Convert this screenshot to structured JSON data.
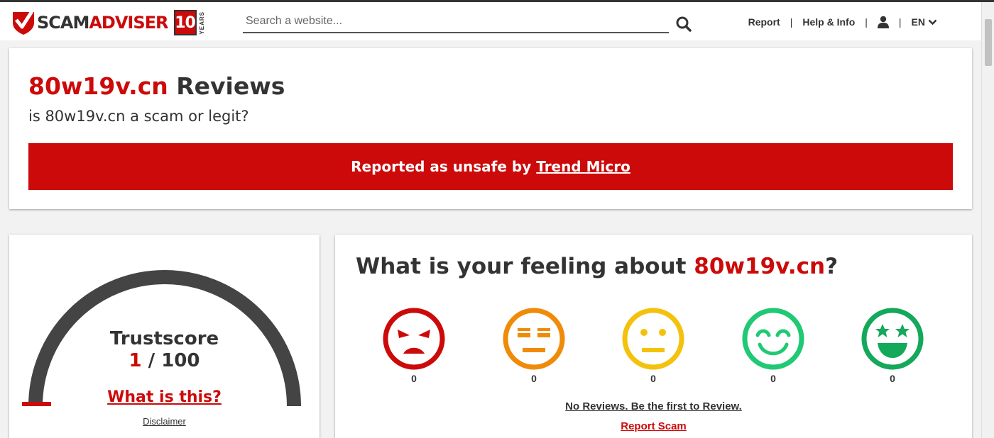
{
  "header": {
    "logo": {
      "scam": "SCAM",
      "adviser": "ADVISER",
      "badge": "10",
      "years": "YEARS"
    },
    "search": {
      "placeholder": "Search a website..."
    },
    "nav": {
      "report": "Report",
      "help": "Help & Info",
      "sep": "|",
      "lang": "EN"
    }
  },
  "main": {
    "domain": "80w19v.cn",
    "title_suffix": " Reviews",
    "subtitle": "is 80w19v.cn a scam or legit?",
    "alert": {
      "text": "Reported as unsafe by",
      "link": "Trend Micro"
    }
  },
  "trust": {
    "label": "Trustscore",
    "score": "1",
    "max": " / 100",
    "score_value": 1,
    "score_max": 100,
    "what_link": "What is this?",
    "disclaimer": "Disclaimer"
  },
  "feeling": {
    "title_prefix": "What is your feeling about ",
    "domain": "80w19v.cn",
    "title_suffix": "?",
    "emojis": [
      {
        "name": "angry",
        "color": "#cc0a0a",
        "count": "0"
      },
      {
        "name": "annoyed",
        "color": "#f08b0a",
        "count": "0"
      },
      {
        "name": "neutral",
        "color": "#f4c20d",
        "count": "0"
      },
      {
        "name": "happy",
        "color": "#20c974",
        "count": "0"
      },
      {
        "name": "star-eyes",
        "color": "#14a85a",
        "count": "0"
      }
    ],
    "no_reviews": "No Reviews. Be the first to Review.",
    "report_scam": "Report Scam"
  },
  "colors": {
    "brand_red": "#cc0a0a",
    "dark": "#333333",
    "gauge": "#444444"
  }
}
